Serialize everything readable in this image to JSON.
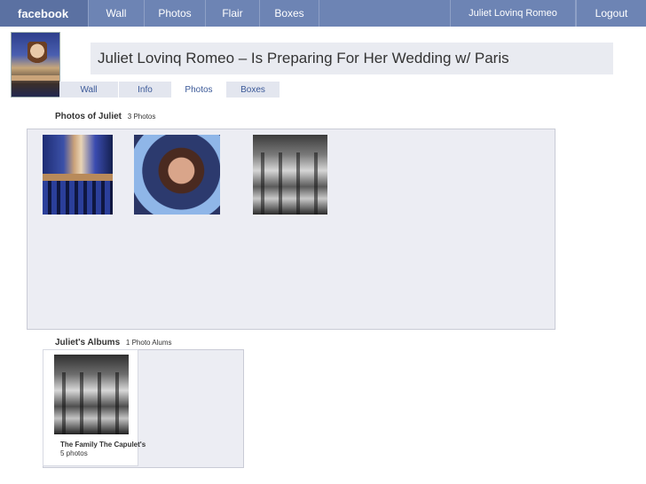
{
  "topbar": {
    "logo": "facebook",
    "nav": [
      "Wall",
      "Photos",
      "Flair",
      "Boxes"
    ],
    "user": "Juliet Lovinq Romeo",
    "logout": "Logout"
  },
  "profile": {
    "status": "Juliet Lovinq Romeo – Is Preparing For Her Wedding w/ Paris",
    "tabs": [
      "Wall",
      "Info",
      "Photos",
      "Boxes"
    ],
    "active_tab": "Photos"
  },
  "photos_section": {
    "title": "Photos of Juliet",
    "count": "3 Photos"
  },
  "albums_section": {
    "title": "Juliet's Albums",
    "count": "1 Photo Alums",
    "albums": [
      {
        "title": "The Family The Capulet's",
        "count": "5 photos"
      }
    ]
  },
  "colors": {
    "topbar": "#6d84b4",
    "logo_bg": "#5b71a2",
    "status_bg": "#e9ebf1",
    "box_bg": "#ecedf3",
    "link": "#3b5998"
  }
}
